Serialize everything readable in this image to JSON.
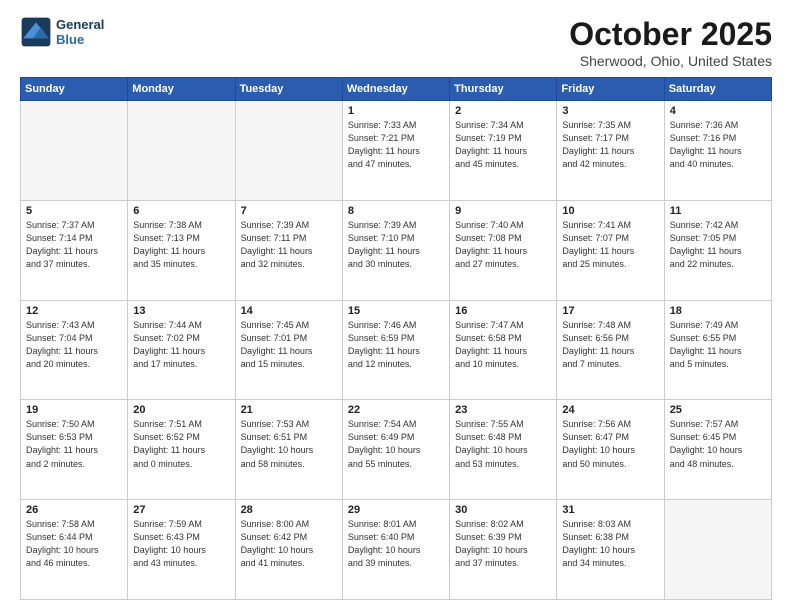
{
  "header": {
    "logo_line1": "General",
    "logo_line2": "Blue",
    "month_year": "October 2025",
    "location": "Sherwood, Ohio, United States"
  },
  "days_of_week": [
    "Sunday",
    "Monday",
    "Tuesday",
    "Wednesday",
    "Thursday",
    "Friday",
    "Saturday"
  ],
  "weeks": [
    [
      {
        "day": "",
        "info": ""
      },
      {
        "day": "",
        "info": ""
      },
      {
        "day": "",
        "info": ""
      },
      {
        "day": "1",
        "info": "Sunrise: 7:33 AM\nSunset: 7:21 PM\nDaylight: 11 hours\nand 47 minutes."
      },
      {
        "day": "2",
        "info": "Sunrise: 7:34 AM\nSunset: 7:19 PM\nDaylight: 11 hours\nand 45 minutes."
      },
      {
        "day": "3",
        "info": "Sunrise: 7:35 AM\nSunset: 7:17 PM\nDaylight: 11 hours\nand 42 minutes."
      },
      {
        "day": "4",
        "info": "Sunrise: 7:36 AM\nSunset: 7:16 PM\nDaylight: 11 hours\nand 40 minutes."
      }
    ],
    [
      {
        "day": "5",
        "info": "Sunrise: 7:37 AM\nSunset: 7:14 PM\nDaylight: 11 hours\nand 37 minutes."
      },
      {
        "day": "6",
        "info": "Sunrise: 7:38 AM\nSunset: 7:13 PM\nDaylight: 11 hours\nand 35 minutes."
      },
      {
        "day": "7",
        "info": "Sunrise: 7:39 AM\nSunset: 7:11 PM\nDaylight: 11 hours\nand 32 minutes."
      },
      {
        "day": "8",
        "info": "Sunrise: 7:39 AM\nSunset: 7:10 PM\nDaylight: 11 hours\nand 30 minutes."
      },
      {
        "day": "9",
        "info": "Sunrise: 7:40 AM\nSunset: 7:08 PM\nDaylight: 11 hours\nand 27 minutes."
      },
      {
        "day": "10",
        "info": "Sunrise: 7:41 AM\nSunset: 7:07 PM\nDaylight: 11 hours\nand 25 minutes."
      },
      {
        "day": "11",
        "info": "Sunrise: 7:42 AM\nSunset: 7:05 PM\nDaylight: 11 hours\nand 22 minutes."
      }
    ],
    [
      {
        "day": "12",
        "info": "Sunrise: 7:43 AM\nSunset: 7:04 PM\nDaylight: 11 hours\nand 20 minutes."
      },
      {
        "day": "13",
        "info": "Sunrise: 7:44 AM\nSunset: 7:02 PM\nDaylight: 11 hours\nand 17 minutes."
      },
      {
        "day": "14",
        "info": "Sunrise: 7:45 AM\nSunset: 7:01 PM\nDaylight: 11 hours\nand 15 minutes."
      },
      {
        "day": "15",
        "info": "Sunrise: 7:46 AM\nSunset: 6:59 PM\nDaylight: 11 hours\nand 12 minutes."
      },
      {
        "day": "16",
        "info": "Sunrise: 7:47 AM\nSunset: 6:58 PM\nDaylight: 11 hours\nand 10 minutes."
      },
      {
        "day": "17",
        "info": "Sunrise: 7:48 AM\nSunset: 6:56 PM\nDaylight: 11 hours\nand 7 minutes."
      },
      {
        "day": "18",
        "info": "Sunrise: 7:49 AM\nSunset: 6:55 PM\nDaylight: 11 hours\nand 5 minutes."
      }
    ],
    [
      {
        "day": "19",
        "info": "Sunrise: 7:50 AM\nSunset: 6:53 PM\nDaylight: 11 hours\nand 2 minutes."
      },
      {
        "day": "20",
        "info": "Sunrise: 7:51 AM\nSunset: 6:52 PM\nDaylight: 11 hours\nand 0 minutes."
      },
      {
        "day": "21",
        "info": "Sunrise: 7:53 AM\nSunset: 6:51 PM\nDaylight: 10 hours\nand 58 minutes."
      },
      {
        "day": "22",
        "info": "Sunrise: 7:54 AM\nSunset: 6:49 PM\nDaylight: 10 hours\nand 55 minutes."
      },
      {
        "day": "23",
        "info": "Sunrise: 7:55 AM\nSunset: 6:48 PM\nDaylight: 10 hours\nand 53 minutes."
      },
      {
        "day": "24",
        "info": "Sunrise: 7:56 AM\nSunset: 6:47 PM\nDaylight: 10 hours\nand 50 minutes."
      },
      {
        "day": "25",
        "info": "Sunrise: 7:57 AM\nSunset: 6:45 PM\nDaylight: 10 hours\nand 48 minutes."
      }
    ],
    [
      {
        "day": "26",
        "info": "Sunrise: 7:58 AM\nSunset: 6:44 PM\nDaylight: 10 hours\nand 46 minutes."
      },
      {
        "day": "27",
        "info": "Sunrise: 7:59 AM\nSunset: 6:43 PM\nDaylight: 10 hours\nand 43 minutes."
      },
      {
        "day": "28",
        "info": "Sunrise: 8:00 AM\nSunset: 6:42 PM\nDaylight: 10 hours\nand 41 minutes."
      },
      {
        "day": "29",
        "info": "Sunrise: 8:01 AM\nSunset: 6:40 PM\nDaylight: 10 hours\nand 39 minutes."
      },
      {
        "day": "30",
        "info": "Sunrise: 8:02 AM\nSunset: 6:39 PM\nDaylight: 10 hours\nand 37 minutes."
      },
      {
        "day": "31",
        "info": "Sunrise: 8:03 AM\nSunset: 6:38 PM\nDaylight: 10 hours\nand 34 minutes."
      },
      {
        "day": "",
        "info": ""
      }
    ]
  ]
}
